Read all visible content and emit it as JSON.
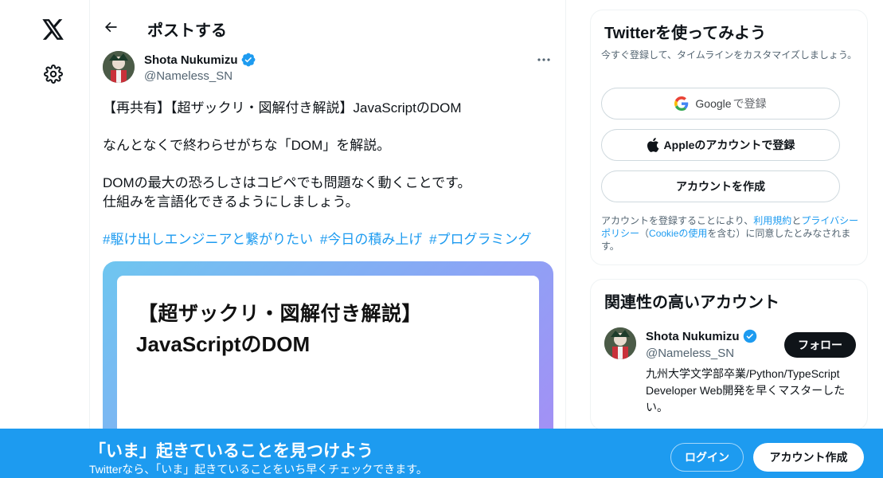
{
  "nav": {
    "logo_icon": "x-logo-icon",
    "settings_icon": "gear-icon"
  },
  "header": {
    "title": "ポストする",
    "back_icon": "arrow-left-icon"
  },
  "post": {
    "author_name": "Shota Nukumizu",
    "author_handle": "@Nameless_SN",
    "verified": true,
    "line1": "【再共有】【超ザックリ・図解付き解説】JavaScriptのDOM",
    "line2": "なんとなくで終わらせがちな「DOM」を解説。",
    "line3": "DOMの最大の恐ろしさはコピペでも問題なく動くことです。",
    "line4": "仕組みを言語化できるようにしましょう。",
    "hashtags": [
      "#駆け出しエンジニアと繋がりたい",
      "#今日の積み上げ",
      "#プログラミング"
    ],
    "media_title_line1": "【超ザックリ・図解付き解説】",
    "media_title_line2": "JavaScriptのDOM"
  },
  "signup": {
    "title": "Twitterを使ってみよう",
    "subtitle": "今すぐ登録して、タイムラインをカスタマイズしましょう。",
    "google_label": "Google",
    "google_suffix": "で登録",
    "apple_label": "Appleのアカウントで登録",
    "create_label": "アカウントを作成",
    "terms_pre": "アカウントを登録することにより、",
    "terms_link1": "利用規約",
    "terms_and": "と",
    "terms_link2": "プライバシーポリシー",
    "terms_paren_open": "（",
    "terms_link3": "Cookieの使用",
    "terms_post": "を含む）に同意したとみなされます。"
  },
  "related": {
    "title": "関連性の高いアカウント",
    "name": "Shota Nukumizu",
    "handle": "@Nameless_SN",
    "follow_label": "フォロー",
    "bio": "九州大学文学部卒業/Python/TypeScript Developer Web開発を早くマスターしたい。"
  },
  "banner": {
    "title": "「いま」起きていることを見つけよう",
    "subtitle": "Twitterなら、「いま」起きていることをいち早くチェックできます。",
    "login_label": "ログイン",
    "signup_label": "アカウント作成"
  },
  "colors": {
    "accent": "#1d9bf0",
    "text": "#0f1419",
    "muted": "#536471"
  }
}
